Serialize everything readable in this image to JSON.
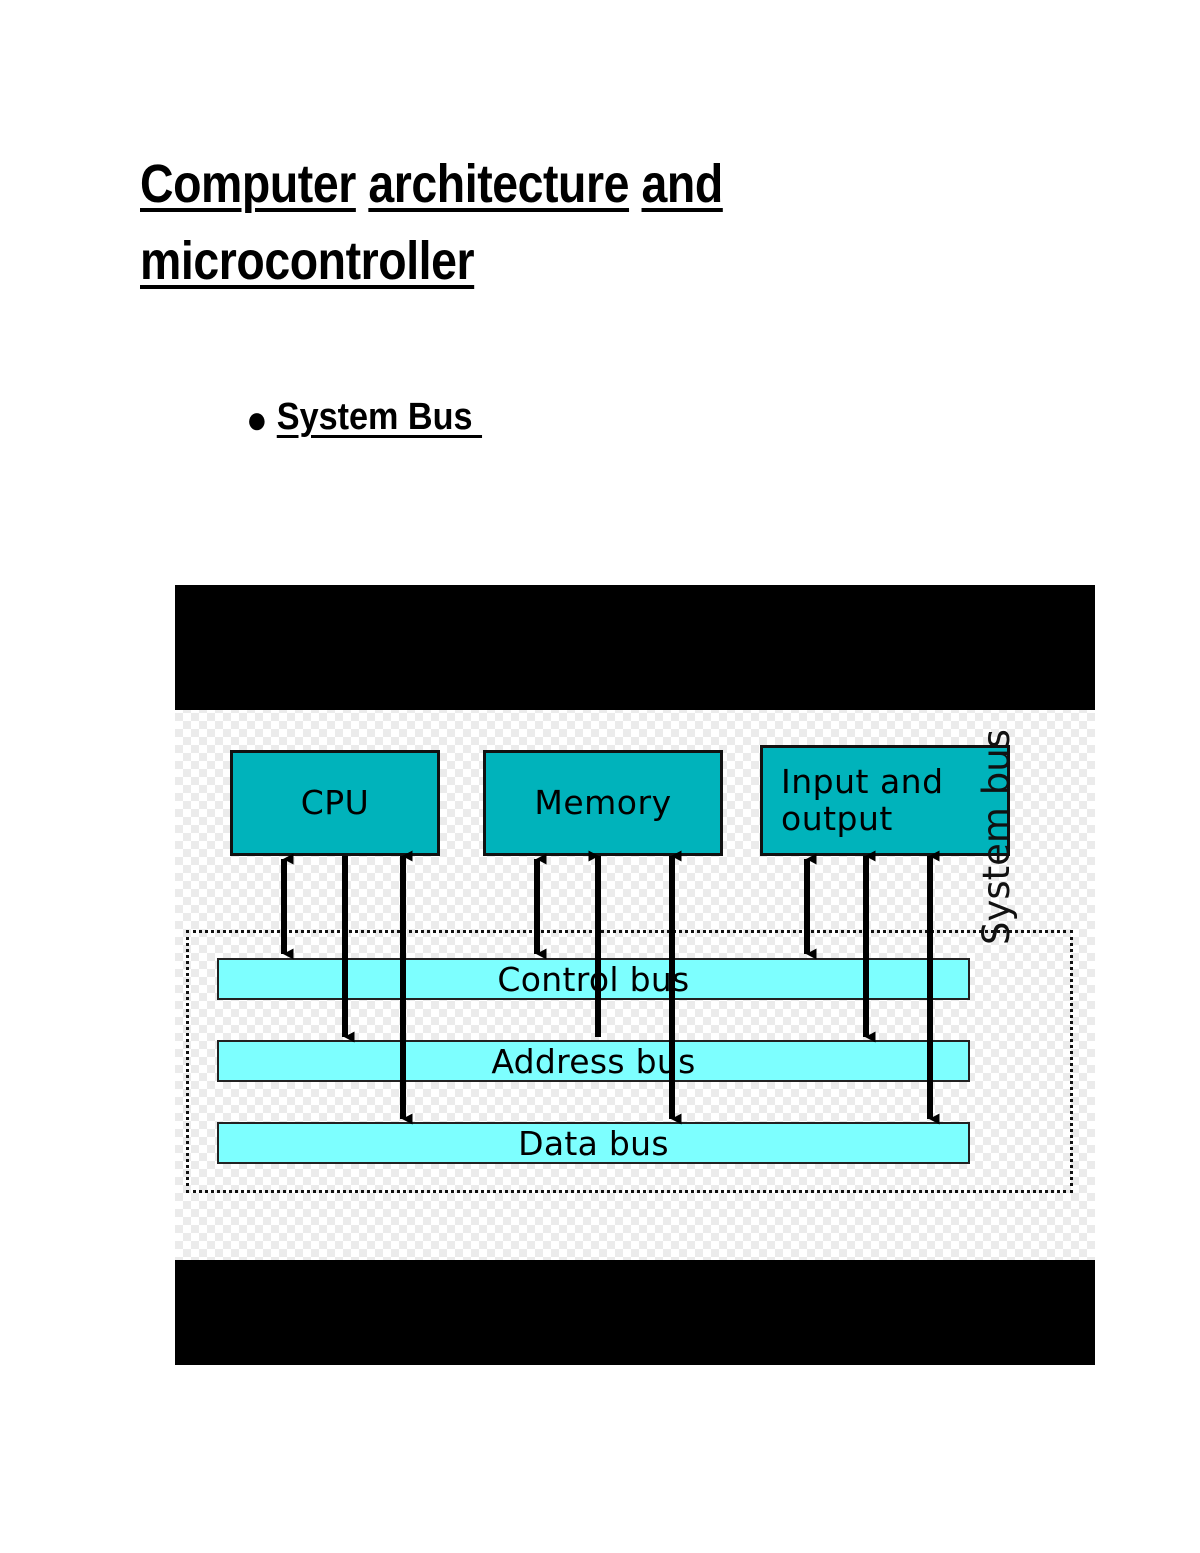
{
  "document": {
    "title_line1_part1": "Computer",
    "title_line1_part2": "architecture",
    "title_line1_part3": "and",
    "title_line2": "microcontroller",
    "bullet_marker": "●",
    "bullet_label": "System Bus "
  },
  "diagram": {
    "components": [
      {
        "id": "cpu",
        "label": "CPU"
      },
      {
        "id": "memory",
        "label": "Memory"
      },
      {
        "id": "io",
        "label": "Input and\noutput"
      }
    ],
    "buses": [
      {
        "id": "control",
        "label": "Control bus"
      },
      {
        "id": "address",
        "label": "Address bus"
      },
      {
        "id": "data",
        "label": "Data bus"
      }
    ],
    "system_bus_label": "System bus",
    "system_bus_chevron": "❯",
    "colors": {
      "component_fill": "#00b3bb",
      "bus_fill": "#7dffff",
      "outline": "#111111",
      "band": "#000000",
      "checker_light": "#ffffff",
      "checker_dark": "#ebebeb",
      "chevron": "#d9d9d9"
    },
    "connections": [
      {
        "from": "cpu",
        "to": "control",
        "direction": "bidirectional"
      },
      {
        "from": "cpu",
        "to": "address",
        "direction": "down"
      },
      {
        "from": "cpu",
        "to": "data",
        "direction": "bidirectional"
      },
      {
        "from": "memory",
        "to": "control",
        "direction": "bidirectional"
      },
      {
        "from": "memory",
        "to": "address",
        "direction": "up"
      },
      {
        "from": "memory",
        "to": "data",
        "direction": "bidirectional"
      },
      {
        "from": "io",
        "to": "control",
        "direction": "bidirectional"
      },
      {
        "from": "io",
        "to": "address",
        "direction": "bidirectional"
      },
      {
        "from": "io",
        "to": "data",
        "direction": "bidirectional"
      }
    ]
  }
}
